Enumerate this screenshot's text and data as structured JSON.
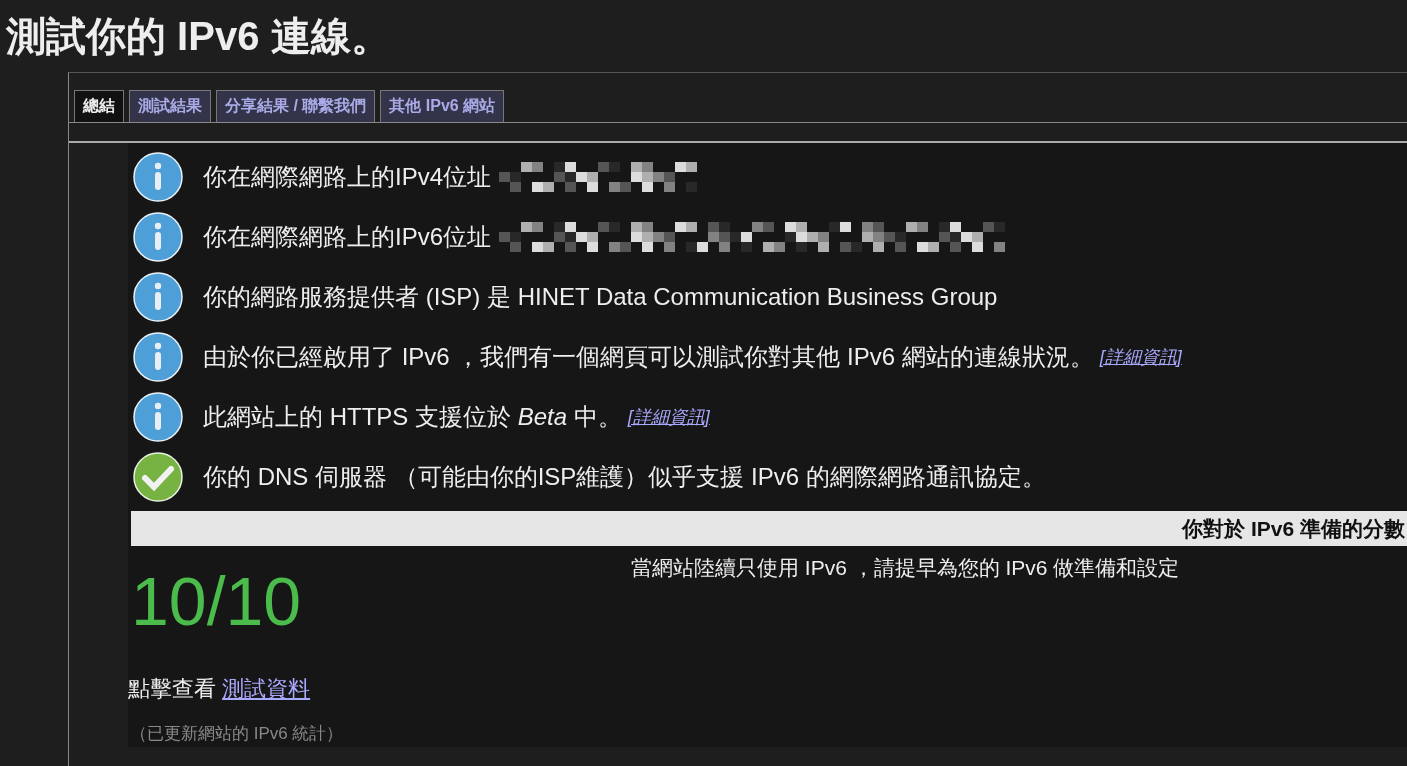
{
  "title": "測試你的 IPv6 連線。",
  "tabs": [
    {
      "label": "總結",
      "selected": true
    },
    {
      "label": "測試結果",
      "selected": false
    },
    {
      "label": "分享結果 / 聯繫我們",
      "selected": false
    },
    {
      "label": "其他 IPv6 網站",
      "selected": false
    }
  ],
  "messages": [
    {
      "kind": "info",
      "text": "你在網際網路上的IPv4位址",
      "redacted": true
    },
    {
      "kind": "info",
      "text": "你在網際網路上的IPv6位址",
      "redacted": true
    },
    {
      "kind": "info",
      "text": "你的網路服務提供者 (ISP) 是 HINET Data Communication Business Group"
    },
    {
      "kind": "info",
      "text": "由於你已經啟用了 IPv6 ，我們有一個網頁可以測試你對其他 IPv6 網站的連線狀況。",
      "link": "[詳細資訊]"
    },
    {
      "kind": "info",
      "text": "此網站上的 HTTPS 支援位於 *Beta* 中。",
      "link": "[詳細資訊]"
    },
    {
      "kind": "ok",
      "text": "你的 DNS 伺服器 （可能由你的ISP維護）似乎支援 IPv6 的網際網路通訊協定。"
    }
  ],
  "score": {
    "heading": "你對於 IPv6 準備的分數",
    "value": "10/10",
    "note": "當網站陸續只使用 IPv6 ，請提早為您的 IPv6 做準備和設定",
    "prompt": "點擊查看",
    "link": "測試資料",
    "footnote": "（已更新網站的 IPv6 統計）"
  }
}
